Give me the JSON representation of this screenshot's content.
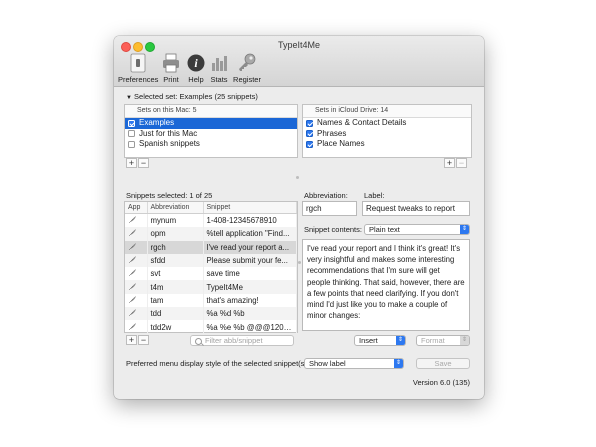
{
  "window": {
    "title": "TypeIt4Me"
  },
  "toolbar": [
    {
      "label": "Preferences",
      "icon": "preferences-icon"
    },
    {
      "label": "Print",
      "icon": "printer-icon"
    },
    {
      "label": "Help",
      "icon": "help-icon"
    },
    {
      "label": "Stats",
      "icon": "stats-icon"
    },
    {
      "label": "Register",
      "icon": "register-icon"
    }
  ],
  "selected_set": "Selected set:  Examples (25 snippets)",
  "sets_local": {
    "header": "Sets on this Mac: 5",
    "items": [
      {
        "label": "Examples",
        "checked": true,
        "selected": true
      },
      {
        "label": "Just for this Mac",
        "checked": false,
        "selected": false
      },
      {
        "label": "Spanish snippets",
        "checked": false,
        "selected": false
      }
    ]
  },
  "sets_icloud": {
    "header": "Sets in iCloud Drive: 14",
    "items": [
      {
        "label": "Names & Contact Details",
        "checked": true
      },
      {
        "label": "Phrases",
        "checked": true
      },
      {
        "label": "Place Names",
        "checked": true
      }
    ]
  },
  "buttons": {
    "add": "+",
    "remove": "−"
  },
  "snippets": {
    "selected_label": "Snippets selected: 1 of 25",
    "columns": [
      "App",
      "Abbreviation",
      "Snippet"
    ],
    "rows": [
      {
        "abbr": "mynum",
        "snippet": "1-408-12345678910"
      },
      {
        "abbr": "opm",
        "snippet": "%tell application \"Find..."
      },
      {
        "abbr": "rgch",
        "snippet": "I've read your report a..."
      },
      {
        "abbr": "sfdd",
        "snippet": "Please submit your fe..."
      },
      {
        "abbr": "svt",
        "snippet": "save time"
      },
      {
        "abbr": "t4m",
        "snippet": "TypeIt4Me"
      },
      {
        "abbr": "tam",
        "snippet": "that's amazing!"
      },
      {
        "abbr": "tdd",
        "snippet": "%a %d %b"
      },
      {
        "abbr": "tdd2w",
        "snippet": "%a %e %b @@@1209..."
      }
    ],
    "highlighted_index": 2
  },
  "search": {
    "placeholder": "Filter abb/snippet"
  },
  "editor": {
    "abbreviation_label": "Abbreviation:",
    "abbreviation_value": "rgch",
    "label_label": "Label:",
    "label_value": "Request tweaks to report",
    "contents_label": "Snippet contents:",
    "contents_type": "Plain text",
    "text": "I've read your report and I think it's great! It's very insightful and makes some interesting recommendations that I'm sure will get people thinking. That said, however, there are a few points that need clarifying. If you don't mind I'd just like you to make a couple of minor changes:",
    "insert_label": "Insert",
    "format_label": "Format"
  },
  "menu_style": {
    "label": "Preferred menu display style of the selected snippet(s):",
    "value": "Show label",
    "save_label": "Save"
  },
  "version": "Version 6.0 (135)",
  "colors": {
    "selection": "#1b67d6",
    "checkbox": "#2d78f0"
  }
}
